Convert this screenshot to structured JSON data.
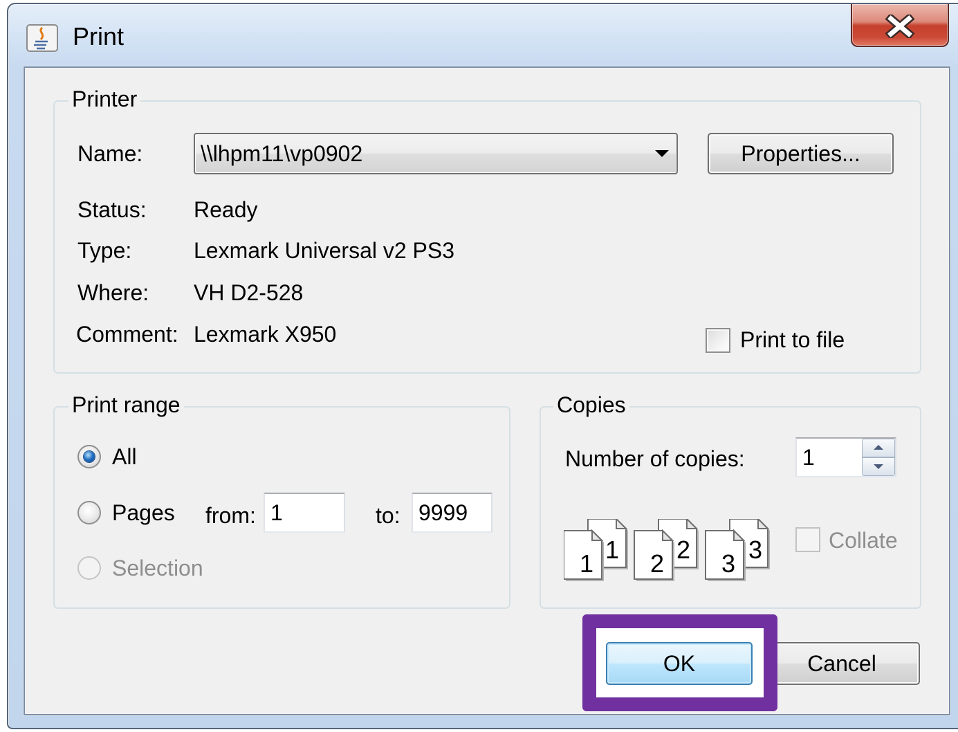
{
  "window": {
    "title": "Print",
    "icon": "java-app-icon",
    "close_icon": "close-icon"
  },
  "printer": {
    "legend": "Printer",
    "name_label": "Name:",
    "name_value": "\\\\lhpm11\\vp0902",
    "properties_button": "Properties...",
    "status_label": "Status:",
    "status_value": "Ready",
    "type_label": "Type:",
    "type_value": "Lexmark Universal v2 PS3",
    "where_label": "Where:",
    "where_value": "VH D2-528",
    "comment_label": "Comment:",
    "comment_value": "Lexmark X950",
    "print_to_file_label": "Print to file",
    "print_to_file_checked": false
  },
  "print_range": {
    "legend": "Print range",
    "all_label": "All",
    "all_selected": true,
    "pages_label": "Pages",
    "pages_selected": false,
    "from_label": "from:",
    "from_value": "1",
    "to_label": "to:",
    "to_value": "9999",
    "selection_label": "Selection",
    "selection_selected": false,
    "selection_enabled": false
  },
  "copies": {
    "legend": "Copies",
    "number_label": "Number of copies:",
    "number_value": "1",
    "collate_label": "Collate",
    "collate_checked": false,
    "collate_enabled": false,
    "collate_preview": [
      {
        "front": "1",
        "back": "1"
      },
      {
        "front": "2",
        "back": "2"
      },
      {
        "front": "3",
        "back": "3"
      }
    ]
  },
  "buttons": {
    "ok": "OK",
    "cancel": "Cancel"
  },
  "colors": {
    "highlight": "#7030a0",
    "focus_border": "#3c7fb1",
    "close_button": "#c6402c",
    "radio_selected": "#1f6bbf"
  }
}
